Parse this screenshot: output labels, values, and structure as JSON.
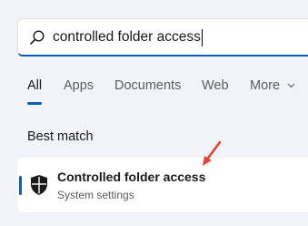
{
  "search": {
    "value": "controlled folder access",
    "icon": "search-icon"
  },
  "tabs": [
    {
      "label": "All",
      "active": true
    },
    {
      "label": "Apps",
      "active": false
    },
    {
      "label": "Documents",
      "active": false
    },
    {
      "label": "Web",
      "active": false
    },
    {
      "label": "More",
      "active": false
    }
  ],
  "section": {
    "best_match_label": "Best match"
  },
  "result": {
    "title": "Controlled folder access",
    "subtitle": "System settings",
    "icon": "shield-icon"
  },
  "colors": {
    "accent": "#0a5fb4",
    "annotation_arrow": "#e8403a",
    "background": "#f1f3f8"
  }
}
